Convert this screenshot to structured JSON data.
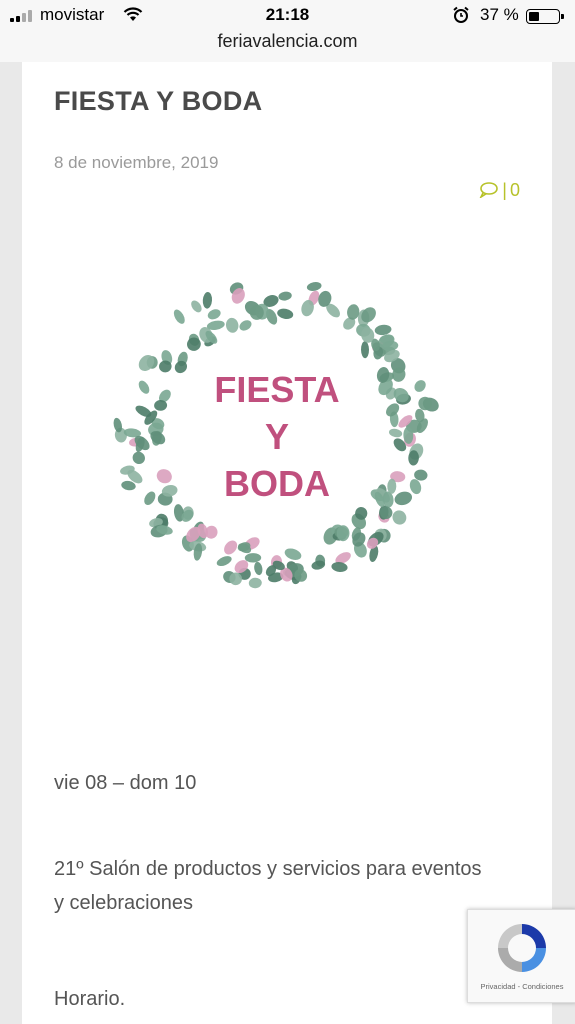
{
  "status_bar": {
    "carrier": "movistar",
    "time": "21:18",
    "battery": "37 %",
    "battery_level": 0.37
  },
  "browser": {
    "url": "feriavalencia.com"
  },
  "article": {
    "title": "FIESTA Y BODA",
    "date": "8 de noviembre, 2019",
    "comment_count": "0",
    "logo": {
      "line1": "FIESTA",
      "line2": "Y",
      "line3": "BODA"
    },
    "dates_text": "vie 08 – dom 10",
    "description": "21º Salón de productos y servicios para eventos y celebraciones",
    "horario": "Horario."
  },
  "recaptcha": {
    "links": "Privacidad - Condiciones"
  },
  "colors": {
    "accent": "#b7c22a",
    "logo_pink": "#c0507e",
    "leaf_green": "#6c9a84"
  },
  "icons": [
    "signal-icon",
    "wifi-icon",
    "alarm-icon",
    "battery-icon",
    "comment-icon",
    "recaptcha-icon"
  ]
}
